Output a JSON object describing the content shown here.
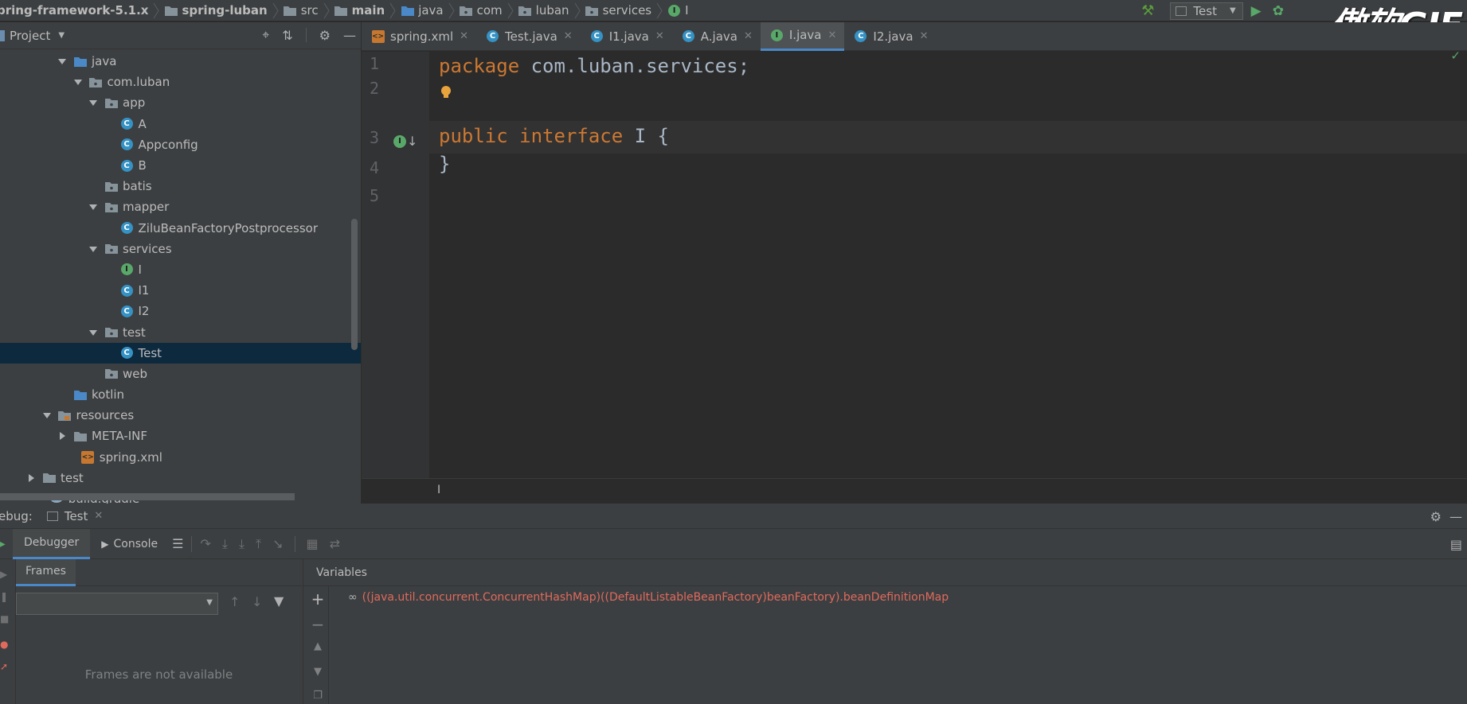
{
  "breadcrumbs": [
    {
      "label": "pring-framework-5.1.x",
      "bold": true,
      "icon": "project-folder-icon"
    },
    {
      "label": "spring-luban",
      "bold": true,
      "icon": "module-folder-icon"
    },
    {
      "label": "src",
      "bold": false,
      "icon": "folder-icon"
    },
    {
      "label": "main",
      "bold": true,
      "icon": "folder-icon"
    },
    {
      "label": "java",
      "bold": false,
      "icon": "source-folder-icon"
    },
    {
      "label": "com",
      "bold": false,
      "icon": "package-icon"
    },
    {
      "label": "luban",
      "bold": false,
      "icon": "package-icon"
    },
    {
      "label": "services",
      "bold": false,
      "icon": "package-icon"
    },
    {
      "label": "I",
      "bold": false,
      "icon": "interface-icon"
    }
  ],
  "toolbar": {
    "run_config": "Test",
    "watermark": "傲软GIF"
  },
  "project_panel": {
    "title": "Project",
    "tree": [
      {
        "label": "java",
        "indent": 0,
        "arrow": "down",
        "icon": "source-folder-icon"
      },
      {
        "label": "com.luban",
        "indent": 1,
        "arrow": "down",
        "icon": "package-icon"
      },
      {
        "label": "app",
        "indent": 2,
        "arrow": "down",
        "icon": "package-icon"
      },
      {
        "label": "A",
        "indent": 3,
        "arrow": "none",
        "icon": "class-icon"
      },
      {
        "label": "Appconfig",
        "indent": 3,
        "arrow": "none",
        "icon": "class-icon"
      },
      {
        "label": "B",
        "indent": 3,
        "arrow": "none",
        "icon": "class-icon"
      },
      {
        "label": "batis",
        "indent": 2,
        "arrow": "none",
        "icon": "package-icon"
      },
      {
        "label": "mapper",
        "indent": 2,
        "arrow": "down",
        "icon": "package-icon"
      },
      {
        "label": "ZiluBeanFactoryPostprocessor",
        "indent": 3,
        "arrow": "none",
        "icon": "class-icon"
      },
      {
        "label": "services",
        "indent": 2,
        "arrow": "down",
        "icon": "package-icon"
      },
      {
        "label": "I",
        "indent": 3,
        "arrow": "none",
        "icon": "interface-icon"
      },
      {
        "label": "I1",
        "indent": 3,
        "arrow": "none",
        "icon": "class-icon"
      },
      {
        "label": "I2",
        "indent": 3,
        "arrow": "none",
        "icon": "class-icon"
      },
      {
        "label": "test",
        "indent": 2,
        "arrow": "down",
        "icon": "package-icon"
      },
      {
        "label": "Test",
        "indent": 3,
        "arrow": "none",
        "icon": "runnable-class-icon",
        "selected": true
      },
      {
        "label": "web",
        "indent": 2,
        "arrow": "none",
        "icon": "package-icon"
      },
      {
        "label": "kotlin",
        "indent": 0,
        "arrow": "none",
        "icon": "source-folder-icon"
      },
      {
        "label": "resources",
        "indent": -1,
        "arrow": "down",
        "icon": "resources-folder-icon"
      },
      {
        "label": "META-INF",
        "indent": 0,
        "arrow": "right",
        "icon": "folder-icon"
      },
      {
        "label": "spring.xml",
        "indent": 0.5,
        "arrow": "none",
        "icon": "xml-file-icon"
      },
      {
        "label": "test",
        "indent": -2,
        "arrow": "right",
        "icon": "folder-icon"
      },
      {
        "label": "build.gradle",
        "indent": -1.5,
        "arrow": "none",
        "icon": "gradle-icon"
      }
    ]
  },
  "editor": {
    "tabs": [
      {
        "label": "spring.xml",
        "icon": "xml-file-icon",
        "active": false
      },
      {
        "label": "Test.java",
        "icon": "class-icon",
        "active": false
      },
      {
        "label": "I1.java",
        "icon": "class-icon",
        "active": false
      },
      {
        "label": "A.java",
        "icon": "class-icon",
        "active": false
      },
      {
        "label": "I.java",
        "icon": "interface-icon",
        "active": true
      },
      {
        "label": "I2.java",
        "icon": "class-icon",
        "active": false
      }
    ],
    "line_numbers": [
      "1",
      "2",
      "3",
      "4",
      "5"
    ],
    "code": {
      "line1_kw": "package",
      "line1_rest": " com.luban.services;",
      "line3_kw1": "public",
      "line3_kw2": "interface",
      "line3_rest": " I {",
      "line4": "}"
    },
    "status_char": "I"
  },
  "debug": {
    "title": "ebug:",
    "session_tab": "Test",
    "tabs": {
      "debugger": "Debugger",
      "console": "Console"
    },
    "frames_header": "Frames",
    "variables_header": "Variables",
    "frames_empty": "Frames are not available",
    "watch_expression": "((java.util.concurrent.ConcurrentHashMap)((DefaultListableBeanFactory)beanFactory).beanDefinitionMap"
  },
  "colors": {
    "keyword": "#cc7832",
    "identifier": "#a9b7c6",
    "class_badge": "#3592c4",
    "interface_badge": "#59a869",
    "error_text": "#e06a5c",
    "selection": "#0d293e"
  }
}
